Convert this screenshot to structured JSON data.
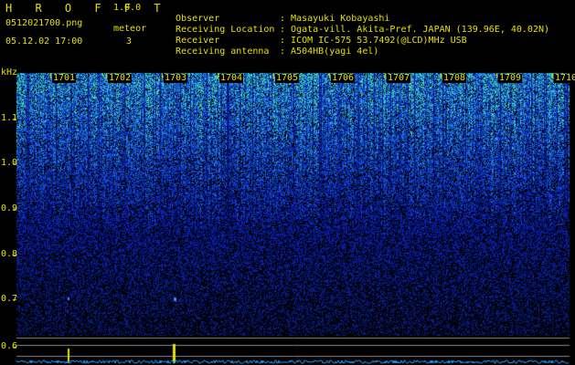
{
  "app": {
    "title": "H R O F F T",
    "version": "1.0.0",
    "filename": "0512021700.png",
    "datetime": "05.12.02 17:00",
    "meteor_label": "meteor",
    "meteor_count": "3"
  },
  "header": {
    "observer_key": "Observer",
    "observer_val": "Masayuki Kobayashi",
    "location_key": "Receiving Location",
    "location_val": "Ogata-vill. Akita-Pref. JAPAN (139.96E, 40.02N)",
    "receiver_key": "Receiver",
    "receiver_val": "ICOM IC-575 53.7492(@LCD)MHz USB",
    "antenna_key": "Receiving antenna",
    "antenna_val": "A504HB(yagi 4el)",
    "colon": ":"
  },
  "chart_data": {
    "type": "heatmap",
    "ylabel": "kHz",
    "y_ticks": [
      "1.1",
      "1.0",
      "0.9",
      "0.8",
      "0.7",
      "0.6"
    ],
    "x_ticks": [
      "1701",
      "1702",
      "1703",
      "1704",
      "1705",
      "1706",
      "1707",
      "1708",
      "1709",
      "1710"
    ],
    "colors": {
      "text": "#e5e000",
      "background": "#000000",
      "spectrum_low": "#0a1a8a",
      "spectrum_high": "#40e0a0",
      "signal": "#e5e000",
      "baseline": "#2aa0ff"
    },
    "meteor_count": 3
  }
}
